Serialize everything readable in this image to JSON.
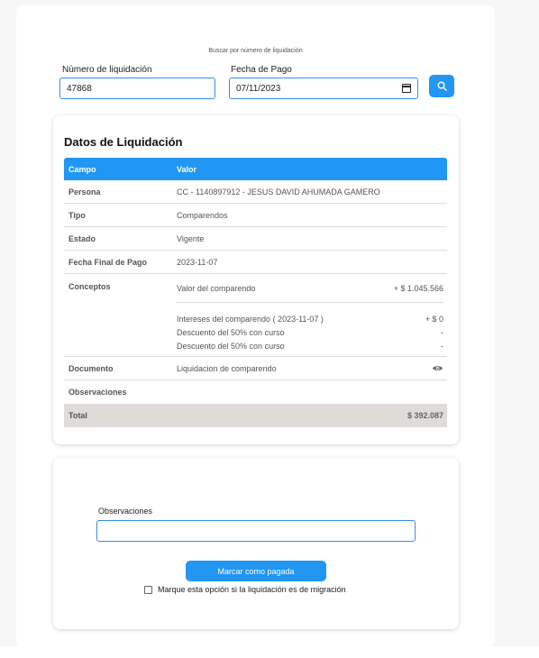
{
  "search": {
    "title": "Buscar por número de liquidación",
    "liquidation_label": "Número de liquidación",
    "liquidation_value": "47868",
    "date_label": "Fecha de Pago",
    "date_value": "07/11/2023"
  },
  "liquidation": {
    "title": "Datos de Liquidación",
    "headers": {
      "field": "Campo",
      "value": "Valor"
    },
    "persona_label": "Persona",
    "persona_value": "CC - 1140897912 - JESUS DAVID AHUMADA GAMERO",
    "tipo_label": "Tipo",
    "tipo_value": "Comparendos",
    "estado_label": "Estado",
    "estado_value": "Vigente",
    "fecha_label": "Fecha Final de Pago",
    "fecha_value": "2023-11-07",
    "conceptos_label": "Conceptos",
    "conceptos": [
      {
        "name": "Valor del comparendo",
        "amount": "+ $ 1.045.566"
      },
      {
        "name": "Intereses del comparendo ( 2023-11-07 )",
        "amount": "+ $ 0"
      },
      {
        "name": "Descuento del 50% con curso",
        "amount": "-"
      },
      {
        "name": "Descuento del 50% con curso",
        "amount": "-"
      }
    ],
    "documento_label": "Documento",
    "documento_value": "Liquidacion de comparendo",
    "observaciones_label": "Observaciones",
    "total_label": "Total",
    "total_value": "$ 392.087"
  },
  "payment": {
    "observations_label": "Observaciones",
    "observations_value": "",
    "mark_paid_label": "Marcar como pagada",
    "migration_checkbox_label": "Marque esta opción si la liquidación es de migración"
  },
  "icons": {
    "search": "search-icon",
    "calendar": "calendar-icon",
    "view": "eye-icon"
  },
  "colors": {
    "accent": "#2196f3",
    "total_row": "#dfdcd8"
  }
}
